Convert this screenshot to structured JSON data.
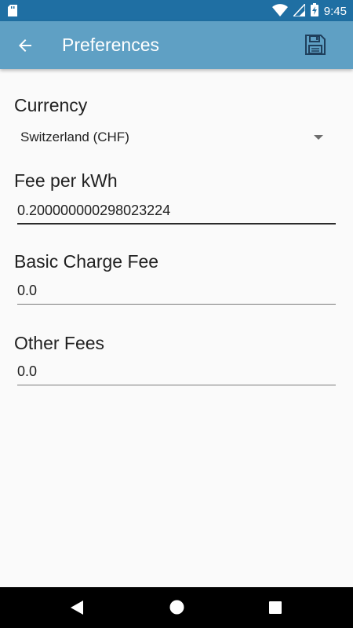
{
  "status_bar": {
    "time": "9:45",
    "icons": [
      "sd-card-icon",
      "wifi-icon",
      "signal-icon",
      "battery-charging-icon"
    ]
  },
  "app_bar": {
    "title": "Preferences",
    "back_icon": "arrow-back-icon",
    "save_icon": "floppy-disk-icon",
    "color": "#5fa0c4"
  },
  "form": {
    "currency": {
      "label": "Currency",
      "selected": "Switzerland (CHF)"
    },
    "fee_per_kwh": {
      "label": "Fee per kWh",
      "value": "0.200000000298023224"
    },
    "basic_charge_fee": {
      "label": "Basic Charge Fee",
      "value": "0.0"
    },
    "other_fees": {
      "label": "Other Fees",
      "value": "0.0"
    }
  },
  "nav_bar": {
    "icons": [
      "back-triangle-icon",
      "home-circle-icon",
      "recents-square-icon"
    ]
  }
}
